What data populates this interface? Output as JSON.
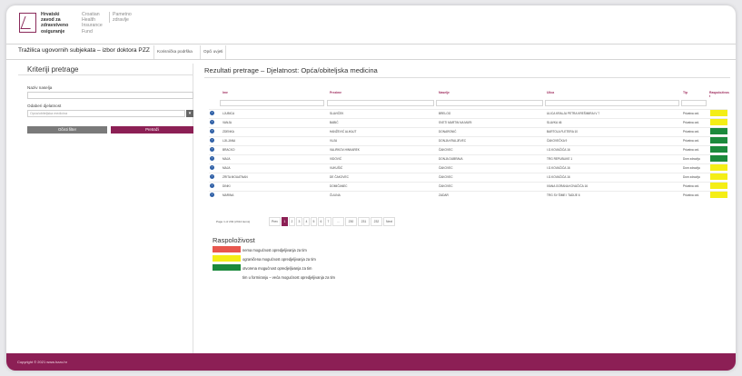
{
  "header": {
    "logo_hr": [
      "Hrvatski",
      "zavod za",
      "zdravstveno",
      "osiguranje"
    ],
    "logo_en": [
      "Croatian",
      "Health",
      "Insurance",
      "Fund"
    ],
    "logo_ext": [
      "Pametno",
      "zdravlje"
    ]
  },
  "tabbar": {
    "title": "Tražilica ugovornih subjekata – izbor doktora PZZ",
    "tabs": [
      "Korisnička podrška",
      "Opći uvjeti"
    ]
  },
  "sidebar": {
    "title": "Kriteriji pretrage",
    "naziv_label": "Naziv naselja",
    "naziv_value": "",
    "djelatnost_label": "Odaberi djelatnost",
    "djelatnost_value": "Opća/obiteljska medicina",
    "select_button": "▾",
    "clear_button": "Očisti filter",
    "search_button": "Pretraži"
  },
  "results": {
    "title": "Rezultati pretrage – Djelatnost: Opća/obiteljska medicina",
    "columns": [
      "Ime",
      "Prezime",
      "Naselje",
      "Ulica",
      "Tip",
      "Raspoloživost"
    ],
    "rows": [
      {
        "ime": "LJUBICA",
        "prezime": "SLAVIČEK",
        "naselje": "BRELOG",
        "ulica": "ULICA KRALJA PETRA KREŠIMIRA IV 7",
        "tip": "Privatna ord.",
        "avail": "yellow"
      },
      {
        "ime": "VANJA",
        "prezime": "BABIĆ",
        "naselje": "SVETI MARTIN NA MURI",
        "ulica": "SLAVKA 46",
        "tip": "Privatna ord.",
        "avail": "yellow"
      },
      {
        "ime": "ZDENKA",
        "prezime": "HANŽEVIĆ ALIKAJT",
        "naselje": "DONARONIĆ",
        "ulica": "BARTOLA FLETERA 10",
        "tip": "Privatna ord.",
        "avail": "green"
      },
      {
        "ime": "LJILJANA",
        "prezime": "VUJA",
        "naselje": "DONJA KRALJEVEC",
        "ulica": "ČAKOVEČKA 9",
        "tip": "Privatna ord.",
        "avail": "green"
      },
      {
        "ime": "BRACKO",
        "prezime": "VALIRKOV-HINKAREK",
        "naselje": "ČAKOVEC",
        "ulica": "I.G.KOVAČIĆA 16",
        "tip": "Privatna ord.",
        "avail": "green"
      },
      {
        "ime": "MAJA",
        "prezime": "VIDOVIĆ",
        "naselje": "DONJA DUBRAVA",
        "ulica": "TRG REPUBLIKE 1",
        "tip": "Dom zdravlja",
        "avail": "green"
      },
      {
        "ime": "MAJA",
        "prezime": "VUKUŠIĆ",
        "naselje": "ČAKOVEC",
        "ulica": "I.G.KOVAČIĆA 16",
        "tip": "Dom zdravlja",
        "avail": "yellow"
      },
      {
        "ime": "ZRITA MOUATNAN",
        "prezime": "DE ČAKOVEC",
        "naselje": "ČAKOVEC",
        "ulica": "I.G.KOVAČIĆA 16",
        "tip": "Dom zdravlja",
        "avail": "yellow"
      },
      {
        "ime": "DINKI",
        "prezime": "DOMIČANEC",
        "naselje": "ČAKOVEC",
        "ulica": "IVANA GORANA KOVAČIĆA 16",
        "tip": "Privatna ord.",
        "avail": "yellow"
      },
      {
        "ime": "MARINA",
        "prezime": "ČULINA",
        "naselje": "ZADAR",
        "ulica": "TRG SV ŠIME I TADIJE 6",
        "tip": "Privatna ord.",
        "avail": "yellow"
      }
    ],
    "pager_info": "Page 1 of 232 (2314 items)",
    "pager": [
      "Prev",
      "1",
      "2",
      "3",
      "4",
      "5",
      "6",
      "7",
      "...",
      "230",
      "231",
      "232",
      "Next"
    ],
    "pager_active": "1"
  },
  "legend": {
    "title": "Raspoloživost",
    "items": [
      {
        "color": "#e8574e",
        "text": "nema mogućnost opredjeljivanja za tim"
      },
      {
        "color": "#f4ee16",
        "text": "ograničena mogućnost opredjeljivanja za tim"
      },
      {
        "color": "#1b8a3c",
        "text": "otvorena mogućnost opredjeljivanja za tim"
      },
      {
        "color": "#ffffff",
        "text": "tim u formiranju – veća mogućnost opredjeljivanja za tim"
      }
    ]
  },
  "footer": {
    "text": "Copyright © 2021 www.hzzo.hr"
  },
  "colors": {
    "brand": "#8c2055",
    "yellow": "#f4ee16",
    "green": "#1b8a3c",
    "red": "#e8574e",
    "icon_blue": "#2e5fa6"
  }
}
